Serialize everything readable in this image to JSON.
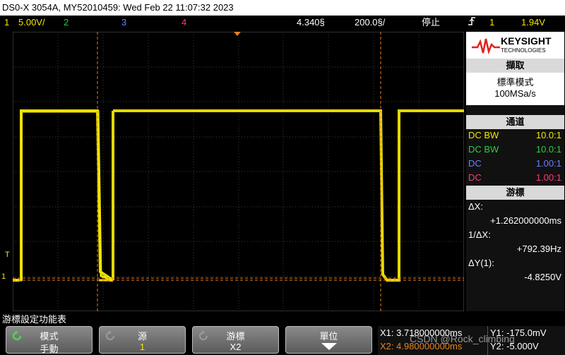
{
  "title": "DS0-X 3054A, MY52010459: Wed Feb 22 11:07:32 2023",
  "status": {
    "ch1_num": "1",
    "ch1_scale": "5.00V/",
    "ch2_num": "2",
    "ch3_num": "3",
    "ch4_num": "4",
    "time_pos": "4.340§",
    "time_scale": "200.0§/",
    "run_state": "停止",
    "trig_icon": "trigger-edge-icon",
    "trig_ch": "1",
    "trig_level": "1.94V"
  },
  "panel": {
    "brand_name": "KEYSIGHT",
    "brand_sub": "TECHNOLOGIES",
    "acquire_header": "擷取",
    "acquire_mode": "標準模式",
    "sample_rate": "100MSa/s",
    "channels_header": "通道",
    "channels": [
      {
        "coupling": "DC BW",
        "probe": "10.0:1",
        "color": "#f2e600"
      },
      {
        "coupling": "DC BW",
        "probe": "10.0:1",
        "color": "#2ecc40"
      },
      {
        "coupling": "DC",
        "probe": "1.00:1",
        "color": "#6e7dff"
      },
      {
        "coupling": "DC",
        "probe": "1.00:1",
        "color": "#ff3a7a"
      }
    ],
    "cursor_header": "游標",
    "dx_label": "ΔX:",
    "dx_value": "+1.262000000ms",
    "inv_dx_label": "1/ΔX:",
    "inv_dx_value": "+792.39Hz",
    "dy_label": "ΔY(1):",
    "dy_value": "-4.8250V"
  },
  "grid_markers": {
    "trig_marker": "T",
    "ch1_marker": "1"
  },
  "softkeys": {
    "menu_title": "游標設定功能表",
    "mode_label": "模式",
    "mode_value": "手動",
    "source_label": "源",
    "source_value": "1",
    "cursors_label": "游標",
    "cursors_value": "X2",
    "units_label": "單位"
  },
  "cursor_readout": {
    "x1": "X1: 3.718000000ms",
    "x2": "X2: 4.980000000ms",
    "y1": "Y1: -175.0mV",
    "y2": "Y2: -5.000V"
  },
  "watermark": "CSDN @Rock_climbing",
  "colors": {
    "ch1": "#f2e600",
    "cursor": "#e8801e",
    "grid": "#444444"
  }
}
